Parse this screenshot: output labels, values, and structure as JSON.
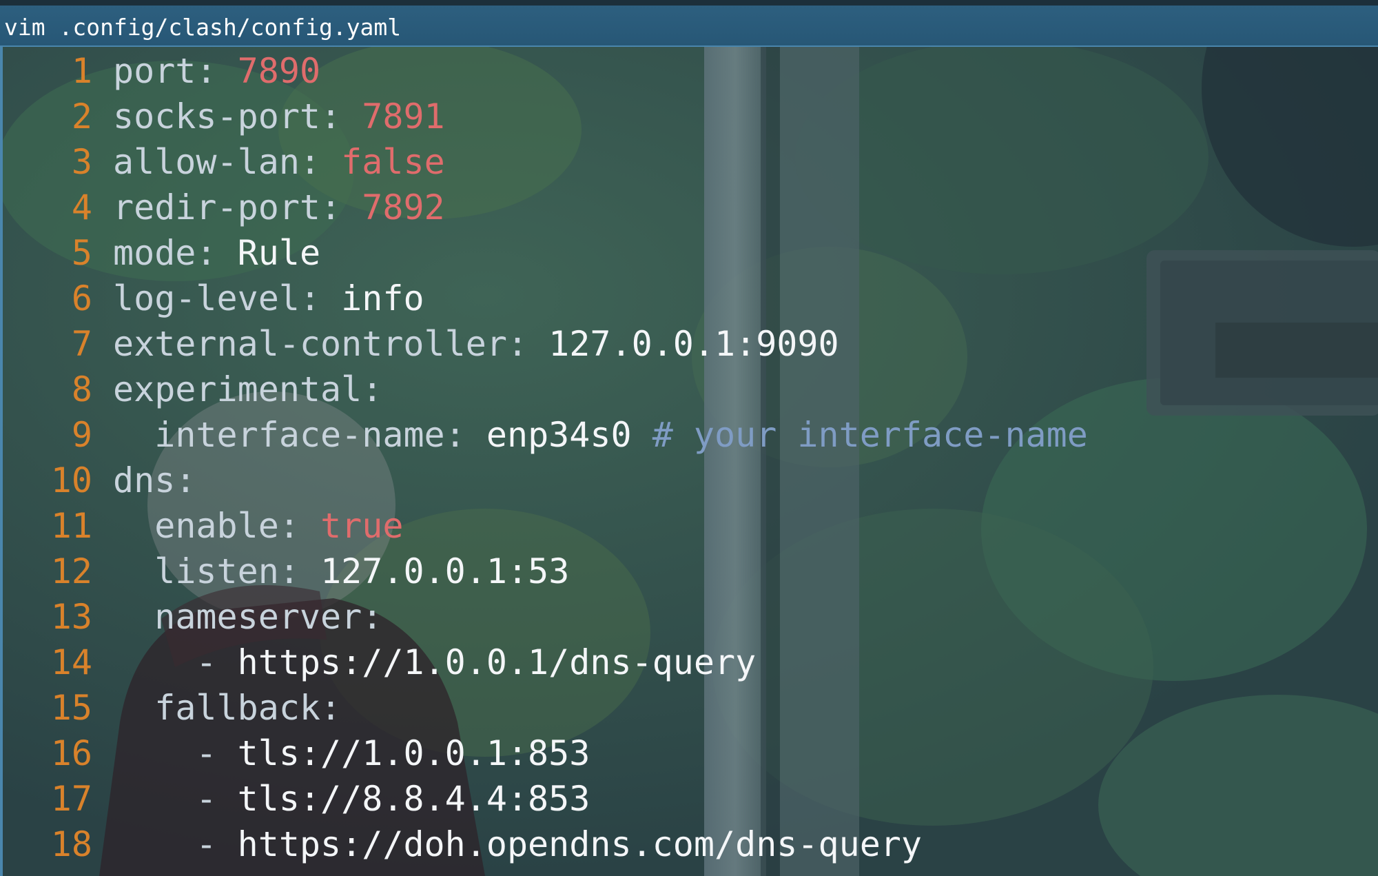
{
  "window": {
    "title": "vim .config/clash/config.yaml"
  },
  "editor": {
    "colors": {
      "line_number": "#d9822b",
      "key": "#c8d3dc",
      "number": "#e06c6c",
      "string": "#f4f6f8",
      "comment": "#7f9cc4"
    },
    "lines": [
      {
        "num": "1",
        "segments": [
          [
            "k",
            "port"
          ],
          [
            "p",
            ": "
          ],
          [
            "n",
            "7890"
          ]
        ]
      },
      {
        "num": "2",
        "segments": [
          [
            "k",
            "socks-port"
          ],
          [
            "p",
            ": "
          ],
          [
            "n",
            "7891"
          ]
        ]
      },
      {
        "num": "3",
        "segments": [
          [
            "k",
            "allow-lan"
          ],
          [
            "p",
            ": "
          ],
          [
            "n",
            "false"
          ]
        ]
      },
      {
        "num": "4",
        "segments": [
          [
            "k",
            "redir-port"
          ],
          [
            "p",
            ": "
          ],
          [
            "n",
            "7892"
          ]
        ]
      },
      {
        "num": "5",
        "segments": [
          [
            "k",
            "mode"
          ],
          [
            "p",
            ": "
          ],
          [
            "s",
            "Rule"
          ]
        ]
      },
      {
        "num": "6",
        "segments": [
          [
            "k",
            "log-level"
          ],
          [
            "p",
            ": "
          ],
          [
            "s",
            "info"
          ]
        ]
      },
      {
        "num": "7",
        "segments": [
          [
            "k",
            "external-controller"
          ],
          [
            "p",
            ": "
          ],
          [
            "s",
            "127.0.0.1:9090"
          ]
        ]
      },
      {
        "num": "8",
        "segments": [
          [
            "k",
            "experimental"
          ],
          [
            "p",
            ":"
          ]
        ]
      },
      {
        "num": "9",
        "segments": [
          [
            "p",
            "  "
          ],
          [
            "k",
            "interface-name"
          ],
          [
            "p",
            ": "
          ],
          [
            "s",
            "enp34s0 "
          ],
          [
            "c",
            "# your interface-name"
          ]
        ]
      },
      {
        "num": "10",
        "segments": [
          [
            "k",
            "dns"
          ],
          [
            "p",
            ":"
          ]
        ]
      },
      {
        "num": "11",
        "segments": [
          [
            "p",
            "  "
          ],
          [
            "k",
            "enable"
          ],
          [
            "p",
            ": "
          ],
          [
            "n",
            "true"
          ]
        ]
      },
      {
        "num": "12",
        "segments": [
          [
            "p",
            "  "
          ],
          [
            "k",
            "listen"
          ],
          [
            "p",
            ": "
          ],
          [
            "s",
            "127.0.0.1:53"
          ]
        ]
      },
      {
        "num": "13",
        "segments": [
          [
            "p",
            "  "
          ],
          [
            "k",
            "nameserver"
          ],
          [
            "p",
            ":"
          ]
        ]
      },
      {
        "num": "14",
        "segments": [
          [
            "p",
            "    - "
          ],
          [
            "s",
            "https://1.0.0.1/dns-query"
          ]
        ]
      },
      {
        "num": "15",
        "segments": [
          [
            "p",
            "  "
          ],
          [
            "k",
            "fallback"
          ],
          [
            "p",
            ":"
          ]
        ]
      },
      {
        "num": "16",
        "segments": [
          [
            "p",
            "    - "
          ],
          [
            "s",
            "tls://1.0.0.1:853"
          ]
        ]
      },
      {
        "num": "17",
        "segments": [
          [
            "p",
            "    - "
          ],
          [
            "s",
            "tls://8.8.4.4:853"
          ]
        ]
      },
      {
        "num": "18",
        "segments": [
          [
            "p",
            "    - "
          ],
          [
            "s",
            "https://doh.opendns.com/dns-query"
          ]
        ]
      }
    ]
  }
}
